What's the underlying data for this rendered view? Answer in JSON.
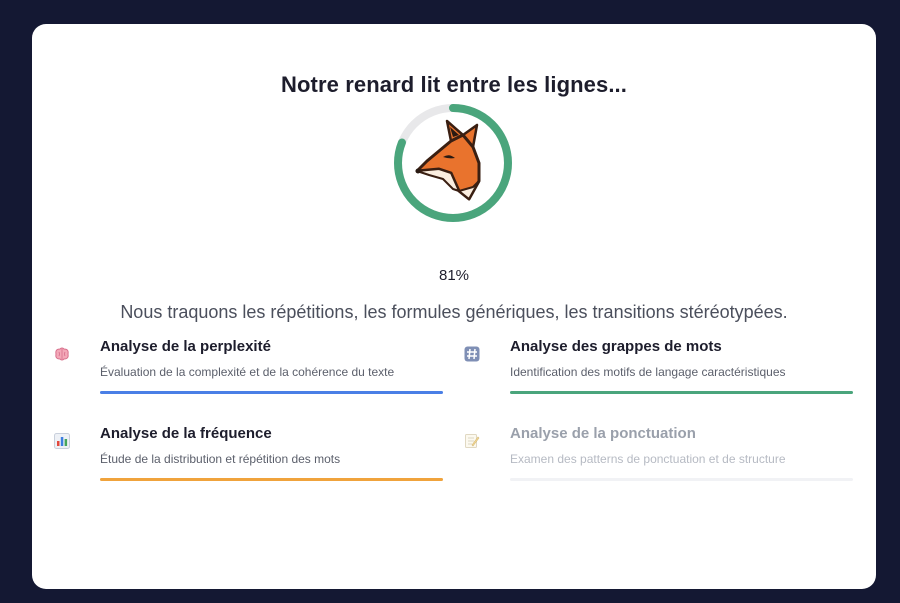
{
  "title": "Notre renard lit entre les lignes...",
  "progress": {
    "percent_label": "81%",
    "value": 0.81,
    "color": "#4aa57c",
    "track_color": "#e8e8ea"
  },
  "subtitle": "Nous traquons les répétitions, les formules génériques, les transitions stéréotypées.",
  "analyses": [
    {
      "icon": "brain-icon",
      "name": "Analyse de la perplexité",
      "description": "Évaluation de la complexité et de la cohérence du texte",
      "progress": 1.0,
      "color": "#4a7fe6",
      "active": true
    },
    {
      "icon": "hash-icon",
      "name": "Analyse des grappes de mots",
      "description": "Identification des motifs de langage caractéristiques",
      "progress": 1.0,
      "color": "#4aa57c",
      "active": true
    },
    {
      "icon": "bar-chart-icon",
      "name": "Analyse de la fréquence",
      "description": "Étude de la distribution et répétition des mots",
      "progress": 1.0,
      "color": "#f0a33c",
      "active": true
    },
    {
      "icon": "memo-icon",
      "name": "Analyse de la ponctuation",
      "description": "Examen des patterns de ponctuation et de structure",
      "progress": 0.0,
      "color": "#cfd3da",
      "active": false
    }
  ]
}
